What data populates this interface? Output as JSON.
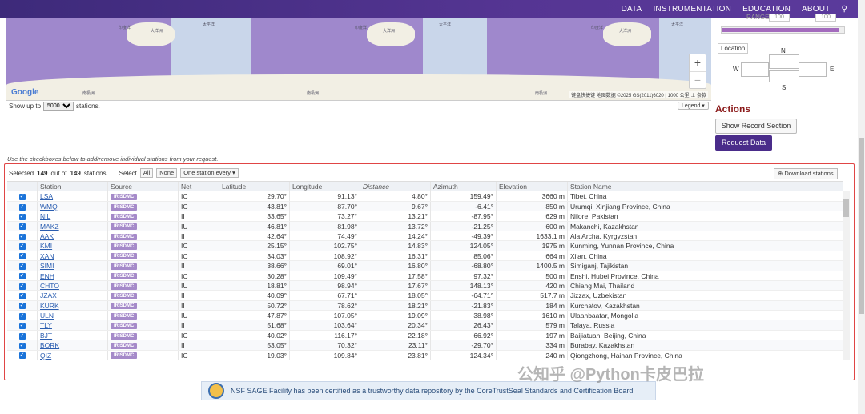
{
  "nav": {
    "items": [
      "DATA",
      "INSTRUMENTATION",
      "EDUCATION",
      "ABOUT"
    ]
  },
  "map": {
    "google": "Google",
    "attribution": "键盘快捷键 地图数据 ©2025 GS(2011)6020 | 1000 公里 ⊥ 条款",
    "labels": [
      "印度洋",
      "大洋洲",
      "太平洋",
      "南极洲",
      "印度洋",
      "大洋洲",
      "太平洋",
      "南极洲",
      "印度洋",
      "大洋洲",
      "太平洋",
      "南极洲"
    ],
    "zoom_in": "+",
    "zoom_out": "−"
  },
  "show_up": {
    "prefix": "Show up to",
    "value": "5000",
    "suffix": "stations."
  },
  "legend_label": "Legend ▾",
  "filters": {
    "range_label": "RANGE",
    "range_min": "100",
    "range_max": "100",
    "location_label": "Location",
    "n": "N",
    "s": "S",
    "w": "W",
    "e": "E"
  },
  "actions": {
    "title": "Actions",
    "record_section": "Show Record Section",
    "request": "Request Data"
  },
  "hint": "Use the checkboxes below to add/remove individual stations from your request.",
  "toolbar": {
    "selected_prefix": "Selected",
    "selected_count": "149",
    "of": "out of",
    "total": "149",
    "suffix": "stations.",
    "select": "Select",
    "all": "All",
    "none": "None",
    "every": "One station every ▾",
    "download": "⊕ Download stations"
  },
  "columns": [
    "",
    "Station",
    "Source",
    "Net",
    "Latitude",
    "Longitude",
    "Distance",
    "Azimuth",
    "Elevation",
    "Station Name"
  ],
  "rows": [
    [
      "LSA",
      "IRISDMC",
      "IC",
      "29.70°",
      "91.13°",
      "4.80°",
      "159.49°",
      "3660 m",
      "Tibet, China"
    ],
    [
      "WMQ",
      "IRISDMC",
      "IC",
      "43.81°",
      "87.70°",
      "9.67°",
      "-6.41°",
      "850 m",
      "Urumqi, Xinjiang Province, China"
    ],
    [
      "NIL",
      "IRISDMC",
      "II",
      "33.65°",
      "73.27°",
      "13.21°",
      "-87.95°",
      "629 m",
      "Nilore, Pakistan"
    ],
    [
      "MAKZ",
      "IRISDMC",
      "IU",
      "46.81°",
      "81.98°",
      "13.72°",
      "-21.25°",
      "600 m",
      "Makanchi, Kazakhstan"
    ],
    [
      "AAK",
      "IRISDMC",
      "II",
      "42.64°",
      "74.49°",
      "14.24°",
      "-49.39°",
      "1633.1 m",
      "Ala Archa, Kyrgyzstan"
    ],
    [
      "KMI",
      "IRISDMC",
      "IC",
      "25.15°",
      "102.75°",
      "14.83°",
      "124.05°",
      "1975 m",
      "Kunming, Yunnan Province, China"
    ],
    [
      "XAN",
      "IRISDMC",
      "IC",
      "34.03°",
      "108.92°",
      "16.31°",
      "85.06°",
      "664 m",
      "Xi'an, China"
    ],
    [
      "SIMI",
      "IRISDMC",
      "II",
      "38.66°",
      "69.01°",
      "16.80°",
      "-68.80°",
      "1400.5 m",
      "Simiganj, Tajikistan"
    ],
    [
      "ENH",
      "IRISDMC",
      "IC",
      "30.28°",
      "109.49°",
      "17.58°",
      "97.32°",
      "500 m",
      "Enshi, Hubei Province, China"
    ],
    [
      "CHTO",
      "IRISDMC",
      "IU",
      "18.81°",
      "98.94°",
      "17.67°",
      "148.13°",
      "420 m",
      "Chiang Mai, Thailand"
    ],
    [
      "JZAX",
      "IRISDMC",
      "II",
      "40.09°",
      "67.71°",
      "18.05°",
      "-64.71°",
      "517.7 m",
      "Jizzax, Uzbekistan"
    ],
    [
      "KURK",
      "IRISDMC",
      "II",
      "50.72°",
      "78.62°",
      "18.21°",
      "-21.83°",
      "184 m",
      "Kurchatov, Kazakhstan"
    ],
    [
      "ULN",
      "IRISDMC",
      "IU",
      "47.87°",
      "107.05°",
      "19.09°",
      "38.98°",
      "1610 m",
      "Ulaanbaatar, Mongolia"
    ],
    [
      "TLY",
      "IRISDMC",
      "II",
      "51.68°",
      "103.64°",
      "20.34°",
      "26.43°",
      "579 m",
      "Talaya, Russia"
    ],
    [
      "BJT",
      "IRISDMC",
      "IC",
      "40.02°",
      "116.17°",
      "22.18°",
      "66.92°",
      "197 m",
      "Baijiatuan, Beijing, China"
    ],
    [
      "BORK",
      "IRISDMC",
      "II",
      "53.05°",
      "70.32°",
      "23.11°",
      "-29.70°",
      "334 m",
      "Burabay, Kazakhstan"
    ],
    [
      "QIZ",
      "IRISDMC",
      "IC",
      "19.03°",
      "109.84°",
      "23.81°",
      "124.34°",
      "240 m",
      "Qiongzhong, Hainan Province, China"
    ]
  ],
  "banner": {
    "text": "NSF SAGE Facility has been certified as a trustworthy data repository by the CoreTrustSeal Standards and Certification Board",
    "seal": "CORE TRUST SEAL"
  },
  "watermark": "公知乎 @Python卡皮巴拉",
  "colors": {
    "nav": "#553593",
    "accent": "#4a2c8a",
    "badge": "#a58ac9",
    "highlight_border": "#e04545"
  }
}
